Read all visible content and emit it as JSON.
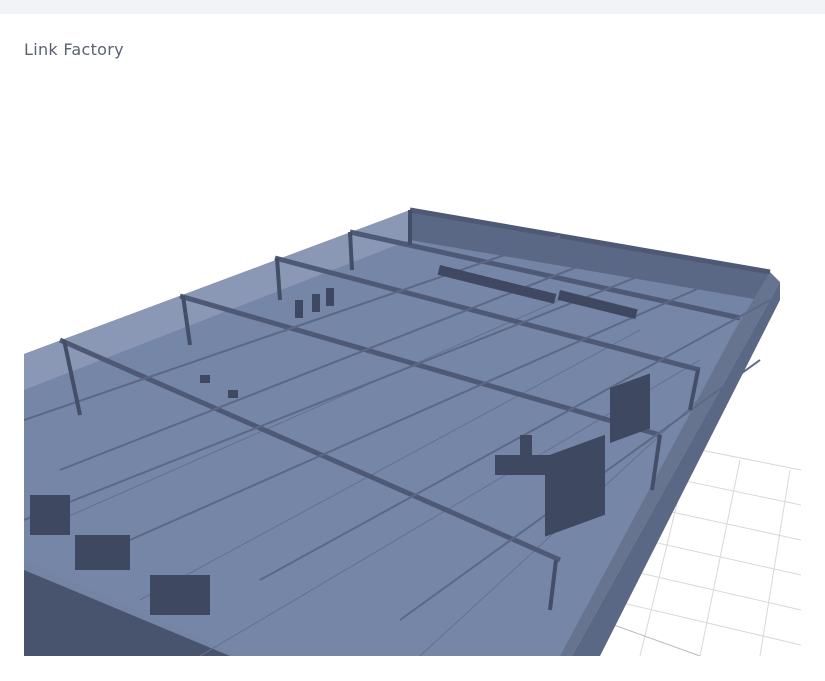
{
  "page": {
    "title": "Link Factory"
  },
  "scene": {
    "model_color": "#6d7c9c",
    "floor_color": "#7282a2",
    "wall_color": "#56627e",
    "dark_color": "#3d475e",
    "grid_color": "#d4d6dc"
  }
}
